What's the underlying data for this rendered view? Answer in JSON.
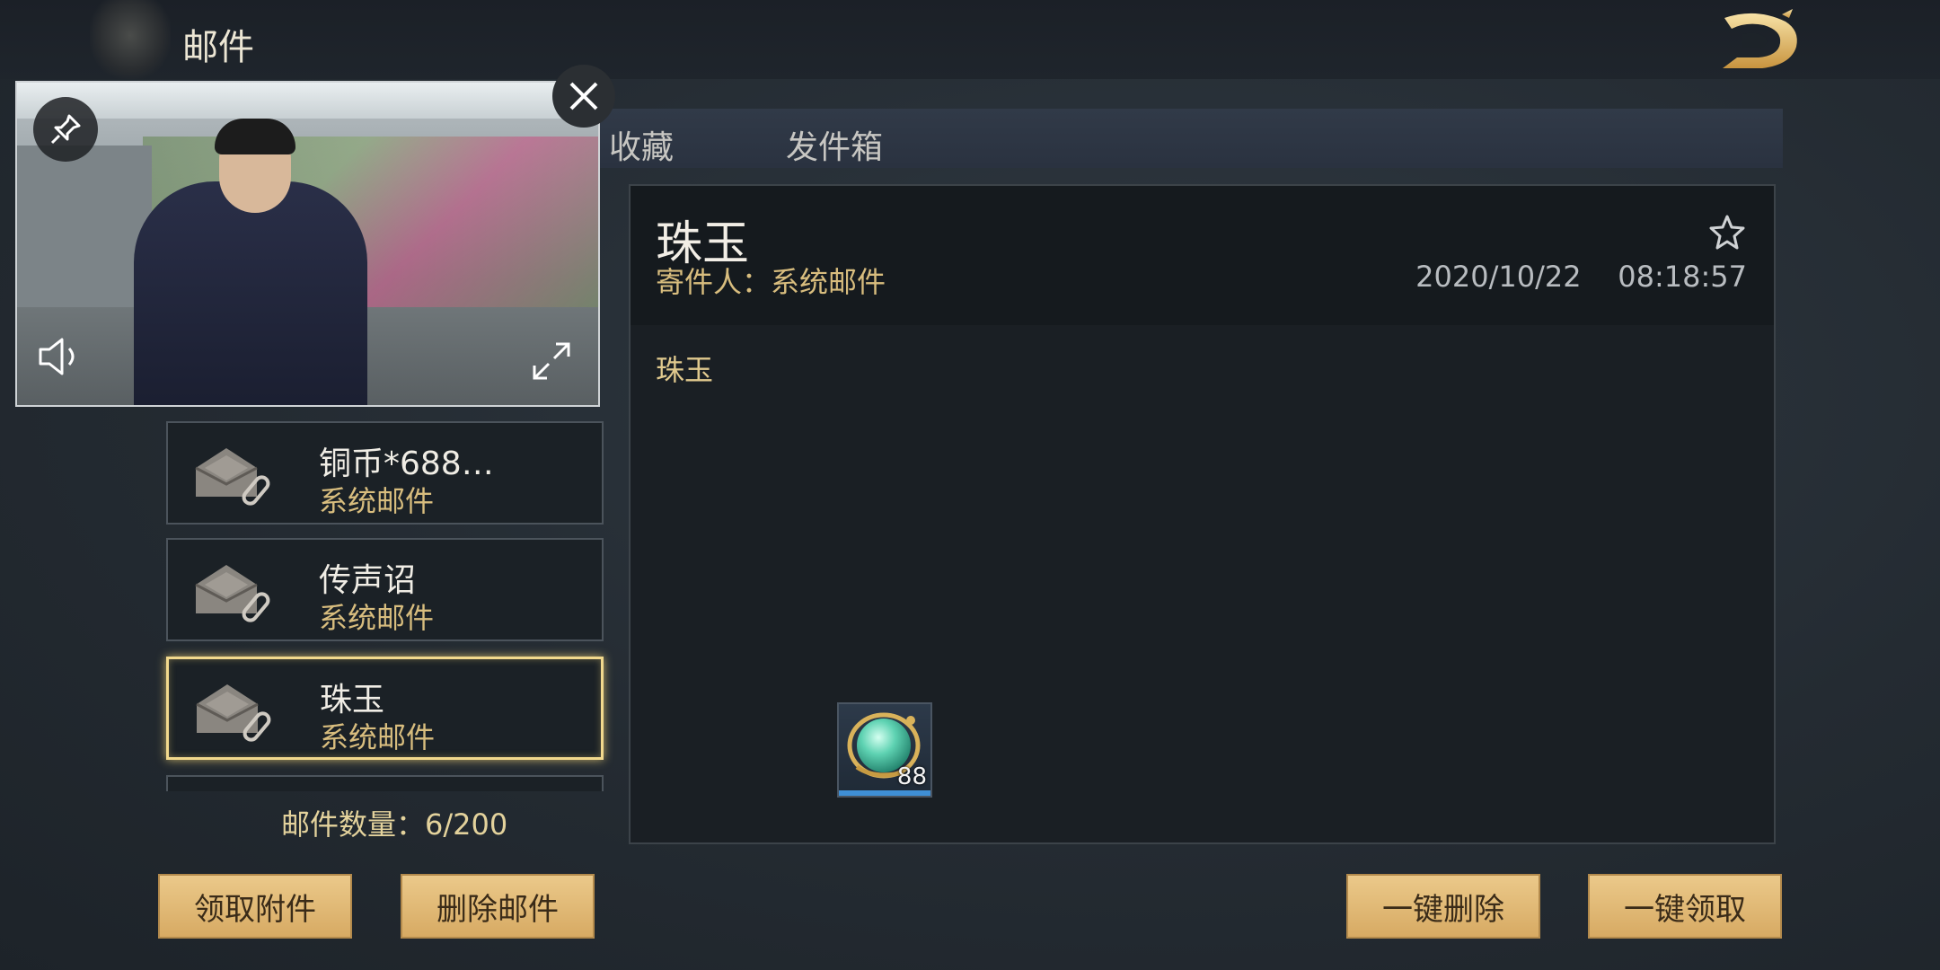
{
  "header": {
    "title": "邮件"
  },
  "tabs": [
    {
      "label": "收藏"
    },
    {
      "label": "发件箱"
    }
  ],
  "mail_list": [
    {
      "title": "铜币*688…",
      "sender": "系统邮件",
      "selected": false
    },
    {
      "title": "传声诏",
      "sender": "系统邮件",
      "selected": false
    },
    {
      "title": "珠玉",
      "sender": "系统邮件",
      "selected": true
    }
  ],
  "mail_count": "邮件数量：6/200",
  "detail": {
    "title": "珠玉",
    "sender": "寄件人：系统邮件",
    "datetime": "2020/10/22    08:18:57",
    "body": "珠玉",
    "attachment": {
      "icon": "jade-orb-icon",
      "count": "88"
    }
  },
  "buttons": {
    "claim_attachment": "领取附件",
    "delete_mail": "删除邮件",
    "delete_all": "一键删除",
    "claim_all": "一键领取"
  },
  "colors": {
    "gold_text": "#d8bd7e",
    "button_gold": "#e4bf7f",
    "selected_border": "#f2d98d",
    "attachment_bar": "#3f8fd6"
  },
  "video_overlay": {
    "icons": [
      "pin-icon",
      "close-icon",
      "volume-icon",
      "fullscreen-icon"
    ]
  }
}
